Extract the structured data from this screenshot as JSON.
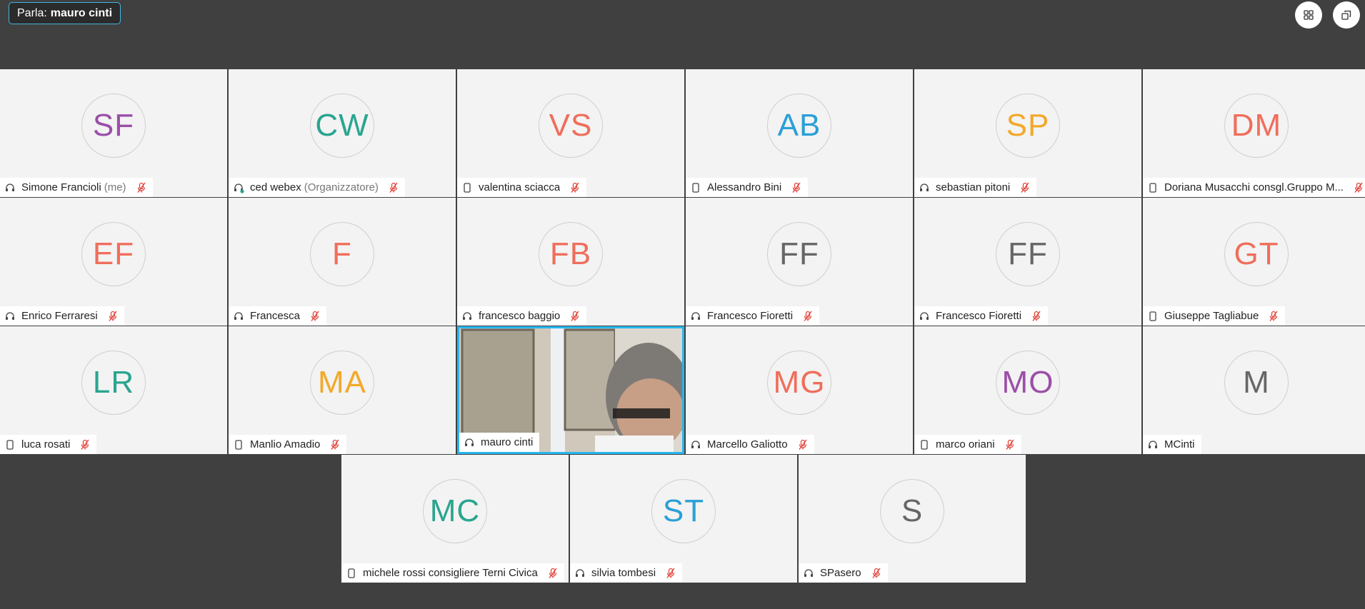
{
  "speaker": {
    "label": "Parla:",
    "name": "mauro cinti"
  },
  "top_controls": {
    "layout_icon": "grid-layout-icon",
    "popout_icon": "popout-window-icon"
  },
  "colors": {
    "background": "#404040",
    "tile": "#f3f3f3",
    "highlight": "#27b7f0",
    "mic_muted": "#e0433a",
    "purple": "#9b4fa8",
    "teal": "#2aa58f",
    "coral": "#ef6e5c",
    "blue": "#2a9fd6",
    "amber": "#f2a92a",
    "gray": "#666666"
  },
  "participants": [
    {
      "initials": "SF",
      "name": "Simone Francioli",
      "role": "(me)",
      "device": "headset",
      "muted": true,
      "color": "#9b4fa8"
    },
    {
      "initials": "CW",
      "name": "ced webex",
      "role": "(Organizzatore)",
      "device": "host",
      "muted": true,
      "color": "#2aa58f"
    },
    {
      "initials": "VS",
      "name": "valentina sciacca",
      "role": "",
      "device": "phone",
      "muted": true,
      "color": "#ef6e5c"
    },
    {
      "initials": "AB",
      "name": "Alessandro Bini",
      "role": "",
      "device": "phone",
      "muted": true,
      "color": "#2a9fd6"
    },
    {
      "initials": "SP",
      "name": "sebastian pitoni",
      "role": "",
      "device": "headset",
      "muted": true,
      "color": "#f2a92a"
    },
    {
      "initials": "DM",
      "name": "Doriana Musacchi consgl.Gruppo M...",
      "role": "",
      "device": "phone",
      "muted": true,
      "color": "#ef6e5c"
    },
    {
      "initials": "EF",
      "name": "Enrico Ferraresi",
      "role": "",
      "device": "headset",
      "muted": true,
      "color": "#ef6e5c"
    },
    {
      "initials": "F",
      "name": "Francesca",
      "role": "",
      "device": "headset",
      "muted": true,
      "color": "#ef6e5c"
    },
    {
      "initials": "FB",
      "name": "francesco baggio",
      "role": "",
      "device": "headset",
      "muted": true,
      "color": "#ef6e5c"
    },
    {
      "initials": "FF",
      "name": "Francesco Fioretti",
      "role": "",
      "device": "headset",
      "muted": true,
      "color": "#666666"
    },
    {
      "initials": "FF",
      "name": "Francesco Fioretti",
      "role": "",
      "device": "headset",
      "muted": true,
      "color": "#666666"
    },
    {
      "initials": "GT",
      "name": "Giuseppe Tagliabue",
      "role": "",
      "device": "phone",
      "muted": true,
      "color": "#ef6e5c"
    },
    {
      "initials": "LR",
      "name": "luca rosati",
      "role": "",
      "device": "phone",
      "muted": true,
      "color": "#2aa58f"
    },
    {
      "initials": "MA",
      "name": "Manlio Amadio",
      "role": "",
      "device": "phone",
      "muted": true,
      "color": "#f2a92a"
    },
    {
      "initials": "",
      "name": "mauro cinti",
      "role": "",
      "device": "headset",
      "muted": false,
      "video": true,
      "color": ""
    },
    {
      "initials": "MG",
      "name": "Marcello Galiotto",
      "role": "",
      "device": "headset",
      "muted": true,
      "color": "#ef6e5c"
    },
    {
      "initials": "MO",
      "name": "marco oriani",
      "role": "",
      "device": "phone",
      "muted": true,
      "color": "#9b4fa8"
    },
    {
      "initials": "M",
      "name": "MCinti",
      "role": "",
      "device": "headset",
      "muted": false,
      "color": "#666666"
    },
    {
      "initials": "MC",
      "name": "michele rossi consigliere Terni Civica",
      "role": "",
      "device": "phone",
      "muted": true,
      "color": "#2aa58f"
    },
    {
      "initials": "ST",
      "name": "silvia tombesi",
      "role": "",
      "device": "headset",
      "muted": true,
      "color": "#2a9fd6"
    },
    {
      "initials": "S",
      "name": "SPasero",
      "role": "",
      "device": "headset",
      "muted": true,
      "color": "#666666"
    }
  ]
}
